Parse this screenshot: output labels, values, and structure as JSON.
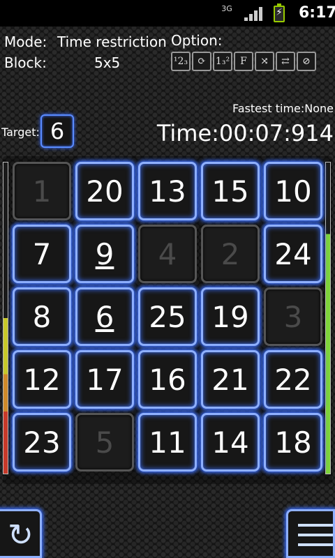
{
  "status": {
    "network": "3G",
    "time": "6:17"
  },
  "info": {
    "mode_label": "Mode:",
    "mode_value": "Time restriction",
    "block_label": "Block:",
    "block_value": "5x5",
    "option_label": "Option:"
  },
  "options": [
    {
      "name": "sequence-option-icon",
      "glyph": "¹2₃"
    },
    {
      "name": "rotate-option-icon",
      "glyph": "⟳"
    },
    {
      "name": "power-sequence-option-icon",
      "glyph": "1₃²"
    },
    {
      "name": "font-option-icon",
      "glyph": "F"
    },
    {
      "name": "shuffle-option-icon",
      "glyph": "⤨"
    },
    {
      "name": "swap-option-icon",
      "glyph": "⇄"
    },
    {
      "name": "mute-option-icon",
      "glyph": "⊘"
    }
  ],
  "fastest": "Fastest time:None",
  "target_label": "Target:",
  "target_value": "6",
  "timer": "Time:00:07:914",
  "progress": {
    "left_level": 0.5,
    "right_level": 0.77
  },
  "grid": [
    [
      {
        "n": "1",
        "done": true
      },
      {
        "n": "20"
      },
      {
        "n": "13"
      },
      {
        "n": "15"
      },
      {
        "n": "10"
      }
    ],
    [
      {
        "n": "7"
      },
      {
        "n": "9",
        "ul": true
      },
      {
        "n": "4",
        "done": true
      },
      {
        "n": "2",
        "done": true
      },
      {
        "n": "24"
      }
    ],
    [
      {
        "n": "8"
      },
      {
        "n": "6",
        "ul": true
      },
      {
        "n": "25"
      },
      {
        "n": "19"
      },
      {
        "n": "3",
        "done": true
      }
    ],
    [
      {
        "n": "12"
      },
      {
        "n": "17"
      },
      {
        "n": "16"
      },
      {
        "n": "21"
      },
      {
        "n": "22"
      }
    ],
    [
      {
        "n": "23"
      },
      {
        "n": "5",
        "done": true
      },
      {
        "n": "11"
      },
      {
        "n": "14"
      },
      {
        "n": "18"
      }
    ]
  ]
}
